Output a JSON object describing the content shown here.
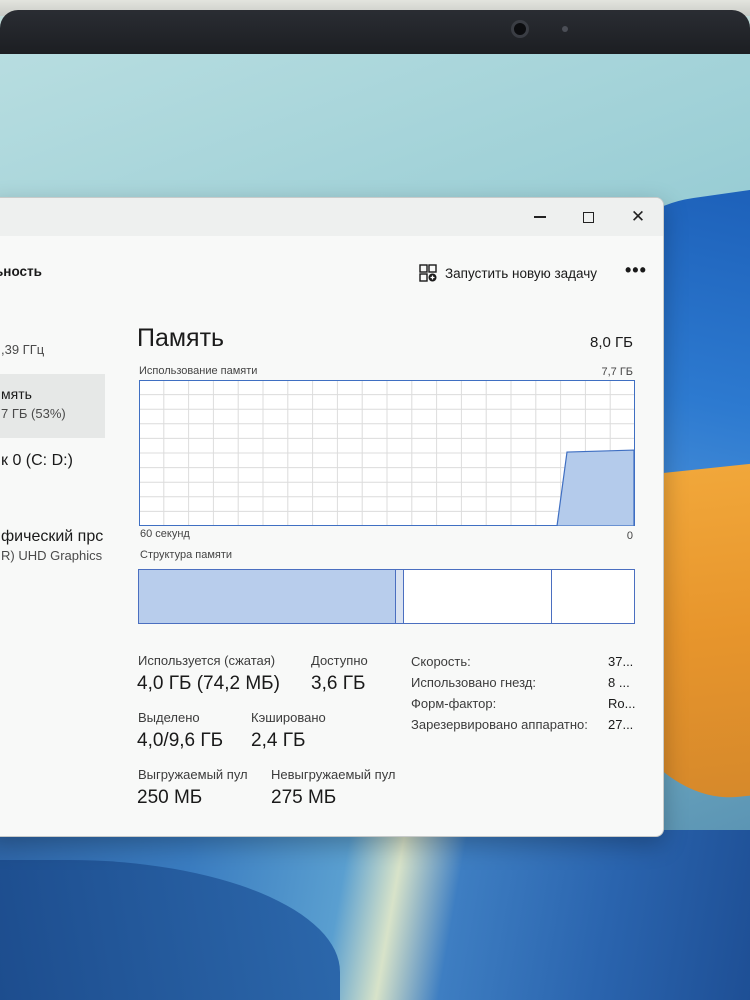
{
  "window": {
    "controls": {
      "minimize": "minimize-icon",
      "maximize": "maximize-icon",
      "close": "close-icon"
    }
  },
  "header": {
    "section_label": "ьность",
    "new_task_label": "Запустить новую задачу",
    "new_task_icon": "new-task-icon",
    "more_label": "•••"
  },
  "sidebar": {
    "items": [
      {
        "title": "",
        "sub": ",39 ГГц"
      },
      {
        "title": "мять",
        "sub": "7 ГБ (53%)"
      },
      {
        "title": "к 0 (C: D:)",
        "sub": ""
      },
      {
        "title": "фический прс",
        "sub": "R) UHD Graphics"
      }
    ]
  },
  "memory": {
    "title": "Память",
    "total": "8,0 ГБ",
    "usage_label": "Использование памяти",
    "usage_max": "7,7 ГБ",
    "axis_left": "60 секунд",
    "axis_right": "0",
    "composition_label": "Структура памяти",
    "composition": {
      "in_use_fraction": 0.52,
      "modified_fraction": 0.015,
      "standby_fraction": 0.3,
      "free_fraction": 0.165
    },
    "stats": {
      "in_use_label": "Используется (сжатая)",
      "in_use_value": "4,0 ГБ (74,2 МБ)",
      "available_label": "Доступно",
      "available_value": "3,6 ГБ",
      "committed_label": "Выделено",
      "committed_value": "4,0/9,6 ГБ",
      "cached_label": "Кэшировано",
      "cached_value": "2,4 ГБ",
      "paged_label": "Выгружаемый пул",
      "paged_value": "250 МБ",
      "nonpaged_label": "Невыгружаемый пул",
      "nonpaged_value": "275 МБ"
    },
    "properties": [
      {
        "label": "Скорость:",
        "value": "37..."
      },
      {
        "label": "Использовано гнезд:",
        "value": "8 ..."
      },
      {
        "label": "Форм-фактор:",
        "value": "Ro..."
      },
      {
        "label": "Зарезервировано аппаратно:",
        "value": "27..."
      }
    ],
    "graph_colors": {
      "line": "#3f6fc2",
      "fill": "#b4cbeb",
      "grid": "#dcdcdc"
    }
  }
}
